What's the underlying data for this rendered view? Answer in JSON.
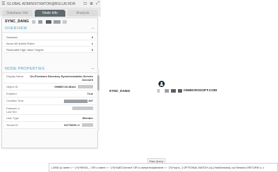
{
  "header": {
    "title": "GLOBAL ADMINISTRATOR@BGLU8.RDR",
    "menu_icon": "hamburger-icon",
    "icons": [
      "pin-icon",
      "database-icon",
      "expand-icon"
    ]
  },
  "tabs": [
    {
      "label": "Database Info",
      "active": false
    },
    {
      "label": "Node Info",
      "active": true
    },
    {
      "label": "Analysis",
      "active": false
    }
  ],
  "node_info": {
    "name": "SYNC_DANG",
    "overview": {
      "heading": "OVERVIEW",
      "rows": [
        {
          "label": "Sessions",
          "value": "0"
        },
        {
          "label": "Azure AD Admin Roles",
          "value": "1"
        },
        {
          "label": "Reachable High Value Targets",
          "value": "0"
        }
      ]
    },
    "node_properties": {
      "heading": "NODE PROPERTIES",
      "rows": [
        {
          "label": "Display Name",
          "value": "On-Premises Directory Synchronization Service Account"
        },
        {
          "label": "Object ID",
          "value": "0998EC19-8DA3"
        },
        {
          "label": "Enabled",
          "value": "True"
        },
        {
          "label": "Creation Time",
          "value": "847"
        },
        {
          "label": "Passwor d Last Set",
          "value": ""
        },
        {
          "label": "User Type",
          "value": "Member"
        },
        {
          "label": "Tenant ID",
          "value": "6477605C-C"
        }
      ]
    }
  },
  "graph": {
    "left_label": "SYNC_DANG",
    "node_icon": "user-icon",
    "node_color": "#0e2530",
    "right_label": "ONMICROSOFT.COM"
  },
  "raw_query": {
    "tab_label": "Raw Query",
    "text": ") AND (u.name =~ '(?i)^MSOL_' OR u.name =~ '(?i)^AADConnect' OR u.userprincipalname =~ '(?i)^sync_') OPTIONAL MATCH (u)-[:HasSession]->(c:Session) RETURN u, c"
  },
  "colors": {
    "accent": "#4a9fc6",
    "active_tab": "#5f6a6e"
  }
}
